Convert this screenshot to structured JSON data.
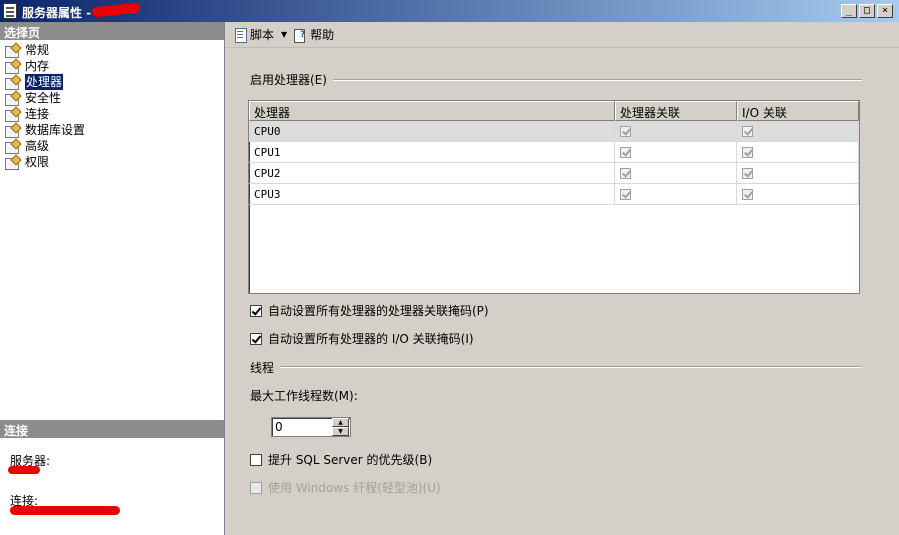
{
  "window": {
    "title": "服务器属性 -",
    "buttons": [
      "_",
      "□",
      "×"
    ]
  },
  "left_pane": {
    "select_page_header": "选择页",
    "pages": [
      {
        "label": "常规",
        "selected": false
      },
      {
        "label": "内存",
        "selected": false
      },
      {
        "label": "处理器",
        "selected": true
      },
      {
        "label": "安全性",
        "selected": false
      },
      {
        "label": "连接",
        "selected": false
      },
      {
        "label": "数据库设置",
        "selected": false
      },
      {
        "label": "高级",
        "selected": false
      },
      {
        "label": "权限",
        "selected": false
      }
    ],
    "connection_header": "连接",
    "server_label": "服务器:",
    "connection_label": "连接:"
  },
  "toolbar": {
    "script_label": "脚本",
    "help_label": "帮助"
  },
  "content": {
    "processors_group_title": "启用处理器(E)",
    "grid": {
      "columns": [
        "处理器",
        "处理器关联",
        "I/O 关联"
      ],
      "rows": [
        {
          "name": "CPU0",
          "affinity": true,
          "io_affinity": true
        },
        {
          "name": "CPU1",
          "affinity": true,
          "io_affinity": true
        },
        {
          "name": "CPU2",
          "affinity": true,
          "io_affinity": true
        },
        {
          "name": "CPU3",
          "affinity": true,
          "io_affinity": true
        }
      ]
    },
    "auto_affinity_label": "自动设置所有处理器的处理器关联掩码(P)",
    "auto_affinity_checked": true,
    "auto_io_affinity_label": "自动设置所有处理器的 I/O 关联掩码(I)",
    "auto_io_affinity_checked": true,
    "threads_group_title": "线程",
    "max_worker_threads_label": "最大工作线程数(M):",
    "max_worker_threads_value": "0",
    "boost_priority_label": "提升 SQL Server 的优先级(B)",
    "boost_priority_checked": false,
    "lightweight_pooling_label": "使用 Windows 纤程(轻型池)(U)",
    "lightweight_pooling_checked": false
  }
}
